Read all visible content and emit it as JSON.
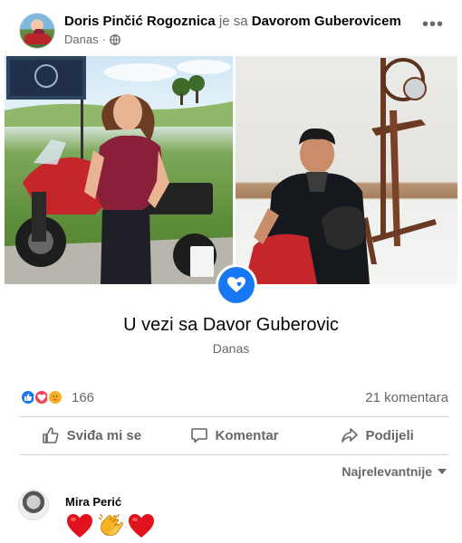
{
  "post": {
    "author": "Doris Pinčić Rogoznica",
    "with_text": "je sa",
    "tagged": "Davorom Guberovicem",
    "time": "Danas",
    "privacy_icon": "globe-icon",
    "menu_icon": "more-horizontal-icon"
  },
  "life_event": {
    "title": "U vezi sa Davor Guberovic",
    "date": "Danas",
    "icon": "heart-icon",
    "accent": "#1877f2"
  },
  "stats": {
    "reactions": [
      "like",
      "love",
      "care"
    ],
    "reaction_count": "166",
    "comments": "21 komentara"
  },
  "actions": [
    {
      "label": "Sviđa mi se",
      "icon": "thumbs-up-icon"
    },
    {
      "label": "Komentar",
      "icon": "comment-icon"
    },
    {
      "label": "Podijeli",
      "icon": "share-icon"
    }
  ],
  "comments_sort": "Najrelevantnije",
  "comment": {
    "author": "Mira Perić",
    "content": "❤👏❤"
  }
}
